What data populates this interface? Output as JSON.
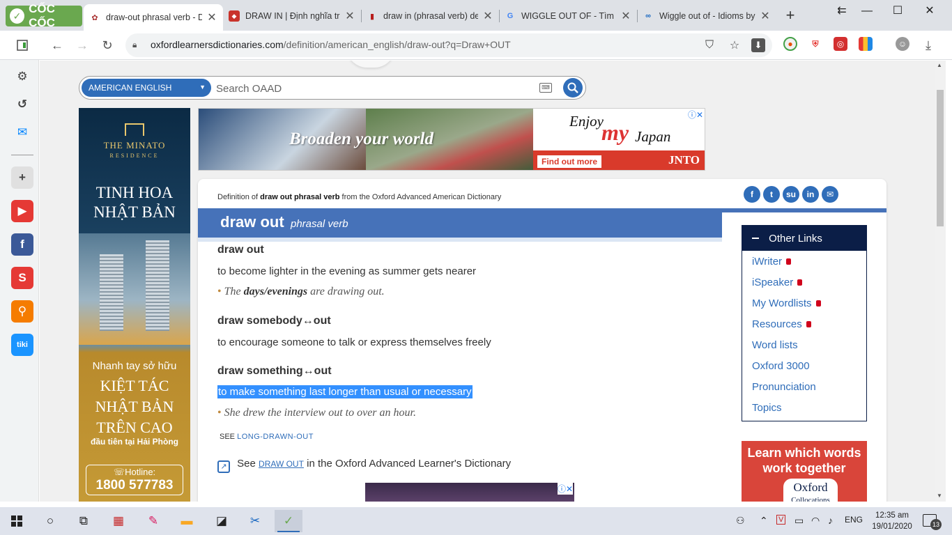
{
  "browser": {
    "brand": "CỐC CỐC",
    "tabs": [
      {
        "title": "draw-out phrasal verb - Definition",
        "active": true
      },
      {
        "title": "DRAW IN | Định nghĩa trong",
        "active": false
      },
      {
        "title": "draw in (phrasal verb) defin",
        "active": false
      },
      {
        "title": "WIGGLE OUT OF - Tìm với",
        "active": false
      },
      {
        "title": "Wiggle out of - Idioms by T",
        "active": false
      }
    ],
    "new_tab": "+",
    "window": {
      "back": "⇇",
      "minimize": "—",
      "maximize": "☐",
      "close": "✕"
    },
    "url_domain": "oxfordlearnersdictionaries.com",
    "url_path": "/definition/american_english/draw-out?q=Draw+OUT"
  },
  "dictionary_search": {
    "selected_dictionary": "AMERICAN ENGLISH",
    "placeholder": "Search OAAD"
  },
  "ads": {
    "left": {
      "brand": "THE MINATO",
      "brand_sub": "RESIDENCE",
      "headline": "TINH HOA NHẬT BẢN",
      "line1": "Nhanh tay sở hữu",
      "line2": "KIỆT TÁC NHẬT BẢN TRÊN CAO",
      "line3": "đầu tiên tại Hải Phòng",
      "hotline_label": "Hotline:",
      "hotline_number": "1800 577783"
    },
    "top": {
      "tagline": "Broaden your world",
      "enjoy": "Enjoy",
      "my": "my",
      "japan": "Japan",
      "cta": "Find out more",
      "sponsor": "JNTO"
    },
    "right": {
      "headline": "Learn which words work together",
      "brand": "Oxford",
      "brand_sub": "Collocations"
    }
  },
  "entry": {
    "definition_of_prefix": "Definition of",
    "definition_of_term": "draw out phrasal verb",
    "definition_of_suffix": "from the Oxford Advanced American Dictionary",
    "headword": "draw out",
    "part_of_speech": "phrasal verb",
    "senses": [
      {
        "phrase": "draw out",
        "definition": "to become lighter in the evening as summer gets nearer",
        "example_prefix": "The",
        "example_bold": "days/evenings",
        "example_suffix": "are drawing out."
      },
      {
        "phrase": "draw somebody↔out",
        "definition": "to encourage someone to talk or express themselves freely"
      },
      {
        "phrase": "draw something↔out",
        "definition": "to make something last longer than usual or necessary",
        "example": "She drew the interview out to over an hour."
      }
    ],
    "see_label": "SEE",
    "see_link": "LONG-DRAWN-OUT",
    "oald_prefix": "See",
    "oald_link": "DRAW OUT",
    "oald_suffix": "in the Oxford Advanced Learner's Dictionary"
  },
  "other_links": {
    "title": "Other Links",
    "items": [
      {
        "label": "iWriter",
        "locked": true
      },
      {
        "label": "iSpeaker",
        "locked": true
      },
      {
        "label": "My Wordlists",
        "locked": true
      },
      {
        "label": "Resources",
        "locked": true
      },
      {
        "label": "Word lists",
        "locked": false
      },
      {
        "label": "Oxford 3000",
        "locked": false
      },
      {
        "label": "Pronunciation",
        "locked": false
      },
      {
        "label": "Topics",
        "locked": false
      }
    ]
  },
  "taskbar": {
    "language": "ENG",
    "time": "12:35 am",
    "date": "19/01/2020",
    "notifications": "13"
  },
  "colors": {
    "oxford_blue": "#2f6db9",
    "headword_bar": "#4672b9",
    "other_links_header": "#0b1e47",
    "selection": "#3390ff"
  }
}
